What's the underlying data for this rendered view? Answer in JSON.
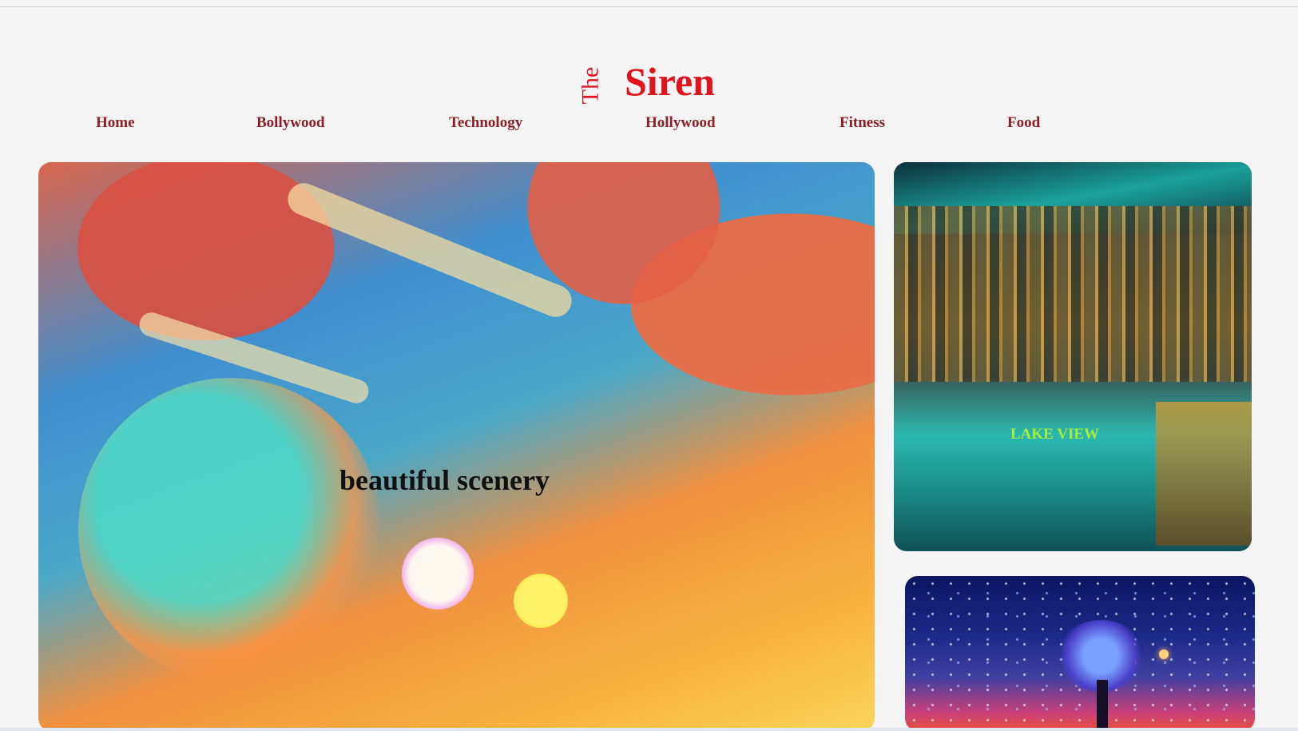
{
  "logo": {
    "the": "The",
    "name": "Siren"
  },
  "nav": [
    "Home",
    "Bollywood",
    "Technology",
    "Hollywood",
    "Fitness",
    "Food"
  ],
  "hero": {
    "caption": "beautiful scenery"
  },
  "side_cards": [
    {
      "caption": "LAKE VIEW"
    },
    {
      "caption": ""
    }
  ],
  "colors": {
    "brand": "#e0141e",
    "nav": "#8c1f24",
    "lake_caption": "#a6f03a"
  }
}
